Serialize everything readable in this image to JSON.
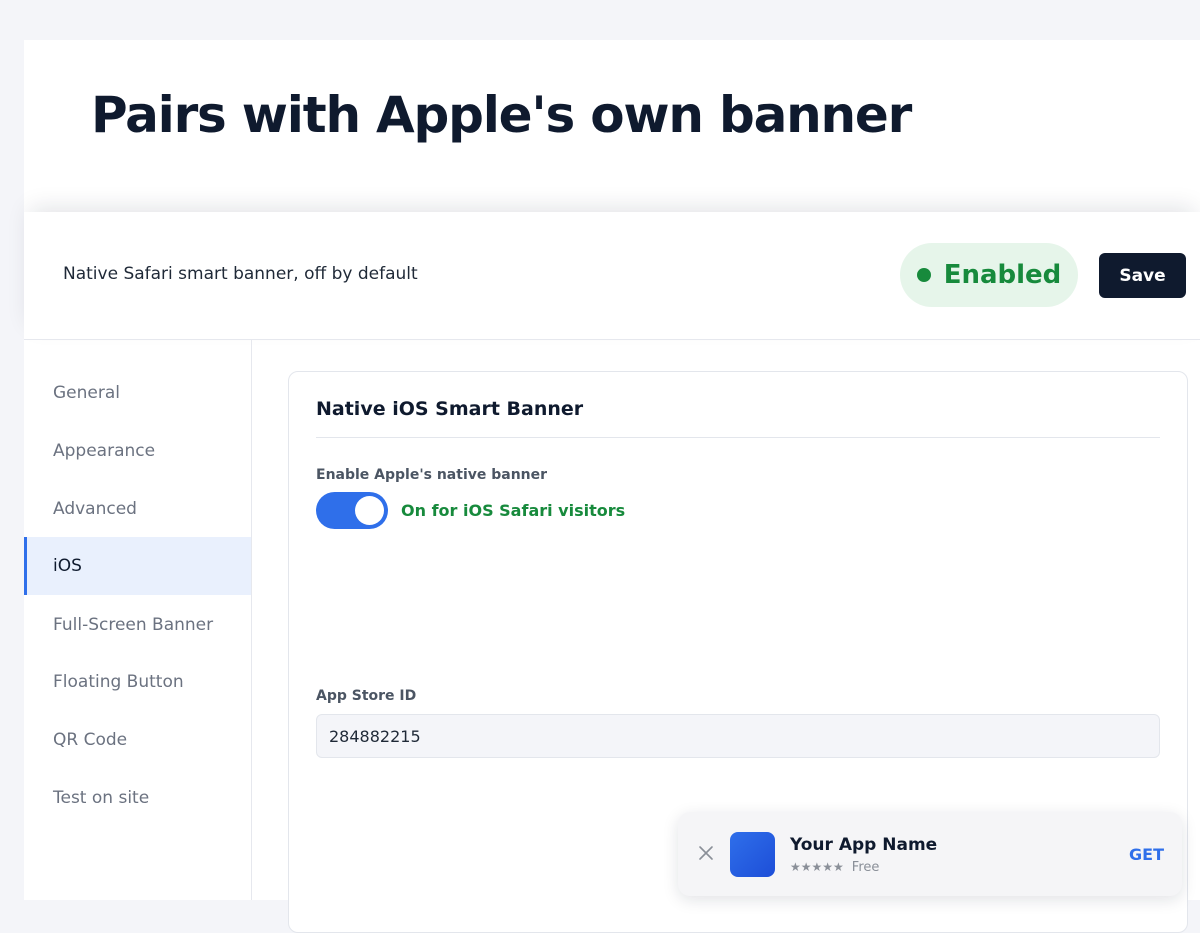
{
  "hero": {
    "title": "Pairs with Apple's own banner"
  },
  "header": {
    "subtitle": "Native Safari smart banner, off by default",
    "status_label": "Enabled",
    "save_label": "Save"
  },
  "sidebar": {
    "items": [
      {
        "label": "General",
        "active": false
      },
      {
        "label": "Appearance",
        "active": false
      },
      {
        "label": "Advanced",
        "active": false
      },
      {
        "label": "iOS",
        "active": true
      },
      {
        "label": "Full-Screen Banner",
        "active": false
      },
      {
        "label": "Floating Button",
        "active": false
      },
      {
        "label": "QR Code",
        "active": false
      },
      {
        "label": "Test on site",
        "active": false
      }
    ]
  },
  "card": {
    "title": "Native iOS Smart Banner",
    "toggle": {
      "label": "Enable Apple's native banner",
      "on": true,
      "status_text": "On for iOS Safari visitors"
    },
    "app_store": {
      "label": "App Store ID",
      "value": "284882215"
    }
  },
  "smart_banner_preview": {
    "app_name": "Your App Name",
    "rating": "★★★★★",
    "price": "Free",
    "action": "GET",
    "close_icon": "close-icon",
    "app_icon": "app-icon"
  },
  "colors": {
    "navy": "#0f1a2e",
    "accent_blue": "#2f6fea",
    "success_green": "#178a3c",
    "success_bg": "#e6f5ea",
    "active_nav_bg": "#e9f0fd"
  }
}
